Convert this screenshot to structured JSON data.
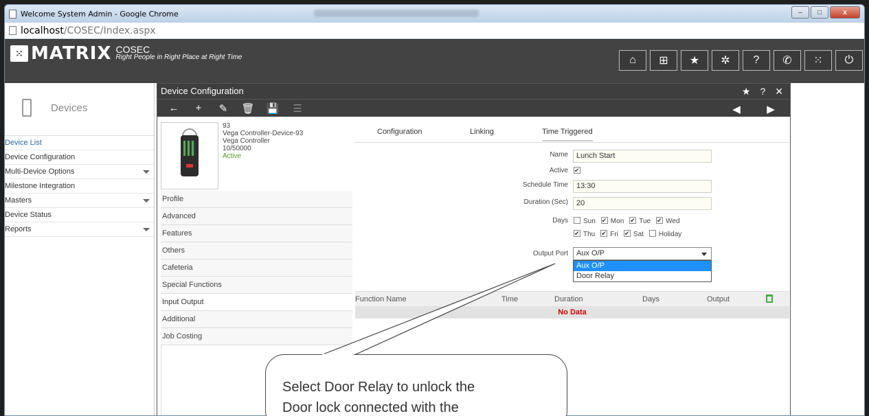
{
  "browser": {
    "title": "Welcome System Admin - Google Chrome",
    "url_host": "localhost",
    "url_path": "/COSEC/Index.aspx",
    "controls": {
      "minimize": "‒",
      "maximize": "□",
      "close": "x"
    }
  },
  "app": {
    "brand": "MATRIX",
    "product": "COSEC",
    "tagline": "Right People in Right Place at Right Time",
    "header_buttons": [
      {
        "icon": "home-icon",
        "glyph": "⌂"
      },
      {
        "icon": "grid-icon",
        "glyph": "⊞"
      },
      {
        "icon": "star-icon",
        "glyph": "★"
      },
      {
        "icon": "gear-icon",
        "glyph": "✲"
      },
      {
        "icon": "help-icon",
        "glyph": "?"
      },
      {
        "icon": "phone-icon",
        "glyph": "✆"
      },
      {
        "icon": "matrix-icon",
        "glyph": "⁙"
      },
      {
        "icon": "power-icon",
        "glyph": "⏻"
      }
    ]
  },
  "sidebar": {
    "title": "Devices",
    "items": [
      {
        "label": "Device List",
        "active": true,
        "has_arrow": false
      },
      {
        "label": "Device Configuration",
        "active": false,
        "has_arrow": false
      },
      {
        "label": "Multi-Device Options",
        "active": false,
        "has_arrow": true
      },
      {
        "label": "Milestone Integration",
        "active": false,
        "has_arrow": false
      },
      {
        "label": "Masters",
        "active": false,
        "has_arrow": true
      },
      {
        "label": "Device Status",
        "active": false,
        "has_arrow": false
      },
      {
        "label": "Reports",
        "active": false,
        "has_arrow": true
      }
    ]
  },
  "dialog": {
    "title": "Device Configuration",
    "controls": {
      "favorite": "★",
      "help": "?",
      "close": "✕"
    },
    "toolbar": {
      "back": "←",
      "add": "+",
      "edit": "✎",
      "delete": "🗑",
      "save": "💾",
      "list": "☰",
      "prev": "◀",
      "next": "▶"
    },
    "device": {
      "id": "93",
      "name": "Vega Controller-Device-93",
      "model": "Vega Controller",
      "users": "10/50000",
      "status": "Active"
    },
    "categories": [
      "Profile",
      "Advanced",
      "Features",
      "Others",
      "Cafeteria",
      "Special Functions",
      "Input Output",
      "Additional",
      "Job Costing"
    ],
    "selected_category": "Input Output",
    "tabs": [
      "Configuration",
      "Linking",
      "Time Triggered"
    ],
    "active_tab": "Time Triggered",
    "form": {
      "name_label": "Name",
      "name_value": "Lunch Start",
      "active_label": "Active",
      "active_checked": true,
      "schedule_label": "Schedule Time",
      "schedule_value": "13:30",
      "duration_label": "Duration (Sec)",
      "duration_value": "20",
      "days_label": "Days",
      "days": [
        {
          "label": "Sun",
          "checked": false
        },
        {
          "label": "Mon",
          "checked": true
        },
        {
          "label": "Tue",
          "checked": true
        },
        {
          "label": "Wed",
          "checked": true
        },
        {
          "label": "Thu",
          "checked": true
        },
        {
          "label": "Fri",
          "checked": true
        },
        {
          "label": "Sat",
          "checked": true
        },
        {
          "label": "Holiday",
          "checked": false
        }
      ],
      "output_label": "Output Port",
      "output_value": "Aux O/P",
      "output_options": [
        "Aux O/P",
        "Door Relay"
      ],
      "output_highlighted": "Aux O/P"
    },
    "grid": {
      "columns": [
        "Function Name",
        "Time",
        "Duration",
        "Days",
        "Output"
      ],
      "empty_text": "No Data"
    }
  },
  "callout": {
    "line1": "Select Door Relay to unlock the",
    "line2": "Door lock connected with the"
  }
}
